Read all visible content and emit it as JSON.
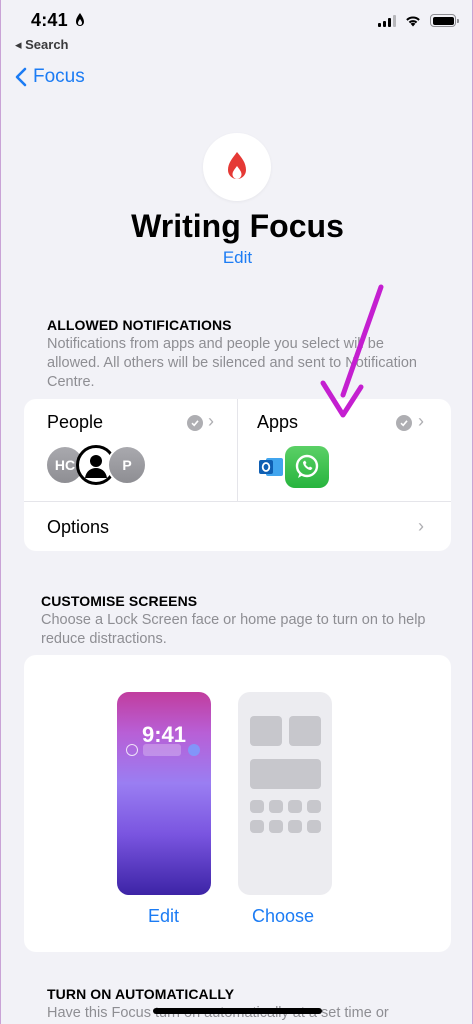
{
  "status_bar": {
    "time": "4:41",
    "back_app": "◂ Search"
  },
  "nav": {
    "back_label": "Focus"
  },
  "header": {
    "title": "Writing Focus",
    "edit_label": "Edit"
  },
  "allowed_notifications": {
    "heading": "ALLOWED NOTIFICATIONS",
    "description": "Notifications from apps and people you select will be allowed. All others will be silenced and sent to Notification Centre.",
    "people": {
      "label": "People",
      "avatars": [
        "HC",
        "P"
      ]
    },
    "apps": {
      "label": "Apps",
      "icons": [
        "outlook-icon",
        "whatsapp-icon"
      ]
    },
    "options": {
      "label": "Options"
    }
  },
  "customise_screens": {
    "heading": "CUSTOMISE SCREENS",
    "description": "Choose a Lock Screen face or home page to turn on to help reduce distractions.",
    "lock_time": "9:41",
    "lock_edit_label": "Edit",
    "home_choose_label": "Choose"
  },
  "turn_on_automatically": {
    "heading": "TURN ON AUTOMATICALLY",
    "description": "Have this Focus turn on automatically at a set time or"
  },
  "colors": {
    "accent": "#1c7cf4",
    "annotation_arrow": "#c41fd0",
    "focus_flame": "#e53935"
  }
}
